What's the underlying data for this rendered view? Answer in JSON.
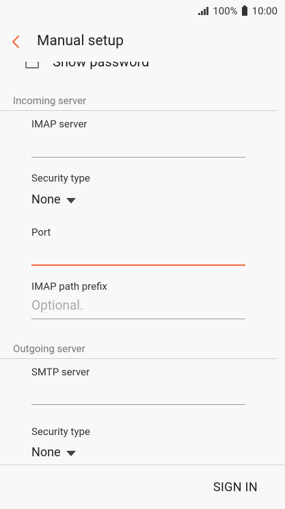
{
  "status_bar": {
    "battery": "100%",
    "time": "10:00"
  },
  "header": {
    "title": "Manual setup"
  },
  "show_password": {
    "label": "Show password",
    "checked": false
  },
  "incoming": {
    "section_title": "Incoming server",
    "imap_server_label": "IMAP server",
    "imap_server_value": "",
    "security_type_label": "Security type",
    "security_type_value": "None",
    "port_label": "Port",
    "port_value": "",
    "imap_path_prefix_label": "IMAP path prefix",
    "imap_path_prefix_placeholder": "Optional."
  },
  "outgoing": {
    "section_title": "Outgoing server",
    "smtp_server_label": "SMTP server",
    "smtp_server_value": "",
    "security_type_label": "Security type",
    "security_type_value": "None"
  },
  "footer": {
    "sign_in_label": "SIGN IN"
  },
  "colors": {
    "accent": "#f26d3d",
    "background": "#f8f8f8",
    "divider": "#d0d0d0"
  }
}
